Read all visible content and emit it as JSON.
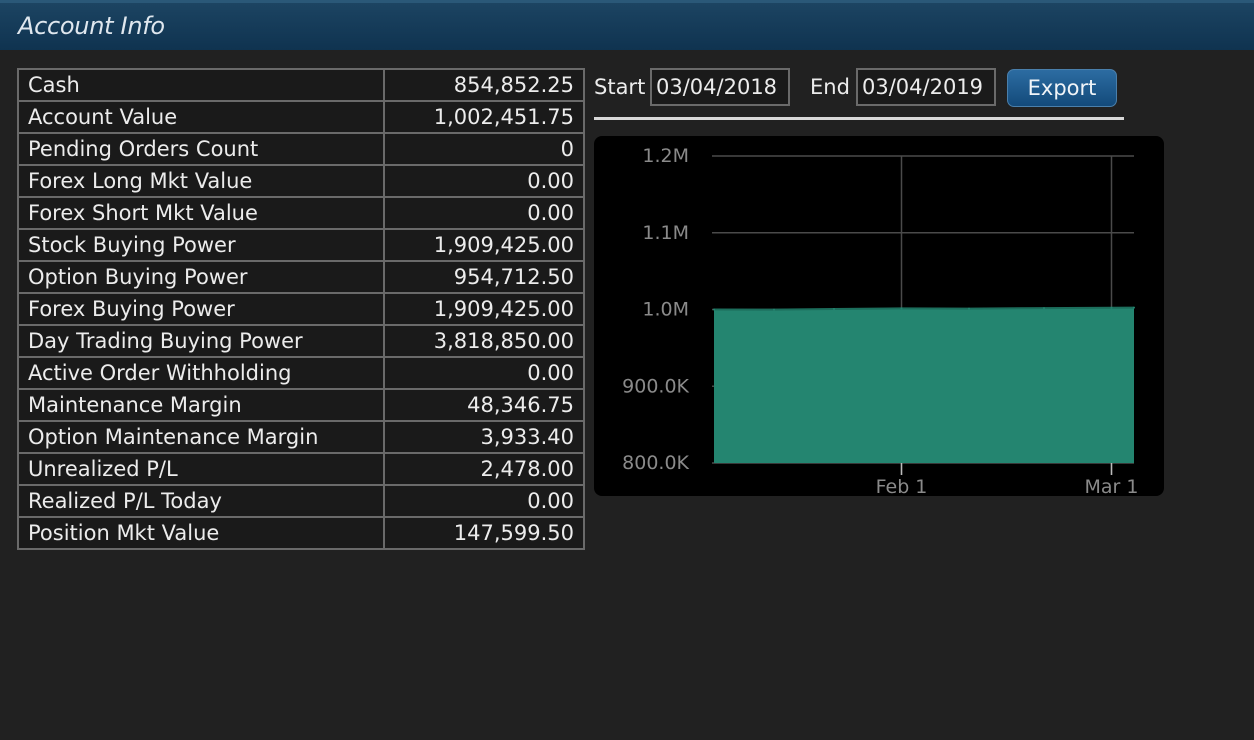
{
  "window": {
    "title": "Account Info"
  },
  "account": {
    "rows": [
      {
        "label": "Cash",
        "value": "854,852.25"
      },
      {
        "label": "Account Value",
        "value": "1,002,451.75"
      },
      {
        "label": "Pending Orders Count",
        "value": "0"
      },
      {
        "label": "Forex Long Mkt Value",
        "value": "0.00"
      },
      {
        "label": "Forex Short Mkt Value",
        "value": "0.00"
      },
      {
        "label": "Stock Buying Power",
        "value": "1,909,425.00"
      },
      {
        "label": "Option Buying Power",
        "value": "954,712.50"
      },
      {
        "label": "Forex Buying Power",
        "value": "1,909,425.00"
      },
      {
        "label": "Day Trading Buying Power",
        "value": "3,818,850.00"
      },
      {
        "label": "Active Order Withholding",
        "value": "0.00"
      },
      {
        "label": "Maintenance Margin",
        "value": "48,346.75"
      },
      {
        "label": "Option Maintenance Margin",
        "value": "3,933.40"
      },
      {
        "label": "Unrealized P/L",
        "value": "2,478.00"
      },
      {
        "label": "Realized P/L Today",
        "value": "0.00"
      },
      {
        "label": "Position Mkt Value",
        "value": "147,599.50"
      }
    ]
  },
  "range": {
    "start_label": "Start",
    "start_value": "03/04/2018",
    "end_label": "End",
    "end_value": "03/04/2019",
    "export_label": "Export"
  },
  "colors": {
    "fill": "#248570",
    "title_bar": "#123a58",
    "button": "#1f5c90"
  },
  "chart_data": {
    "type": "area",
    "title": "",
    "xlabel": "",
    "ylabel": "",
    "x": [
      "2019-01-07",
      "2019-01-15",
      "2019-01-23",
      "2019-02-01",
      "2019-02-10",
      "2019-02-20",
      "2019-03-01",
      "2019-03-04"
    ],
    "values": [
      1000000,
      999800,
      1000600,
      1001500,
      1001200,
      1001800,
      1002200,
      1002450
    ],
    "xlim": [
      "2019-01-07",
      "2019-03-04"
    ],
    "ylim": [
      800000,
      1200000
    ],
    "yticks": [
      {
        "value": 1200000,
        "label": "1.2M"
      },
      {
        "value": 1100000,
        "label": "1.1M"
      },
      {
        "value": 1000000,
        "label": "1.0M"
      },
      {
        "value": 900000,
        "label": "900.0K"
      },
      {
        "value": 800000,
        "label": "800.0K"
      }
    ],
    "xticks": [
      {
        "value": "2019-02-01",
        "label": "Feb 1"
      },
      {
        "value": "2019-03-01",
        "label": "Mar 1"
      }
    ],
    "grid": true,
    "legend": "none"
  }
}
